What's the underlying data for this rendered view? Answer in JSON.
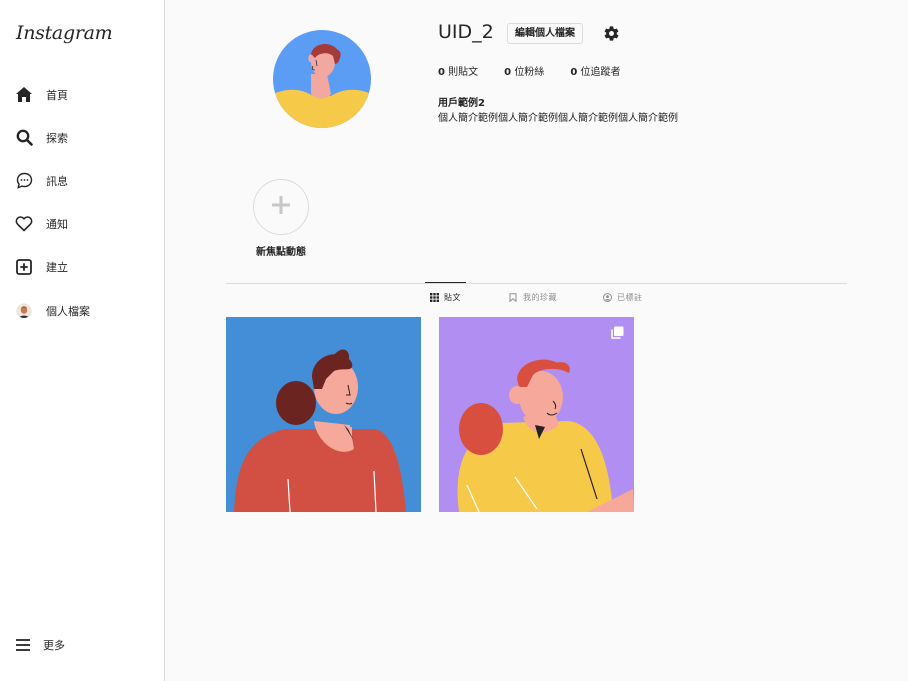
{
  "sidebar": {
    "logo": "Instagram",
    "items": [
      {
        "label": "首頁",
        "icon": "home-icon"
      },
      {
        "label": "探索",
        "icon": "search-icon"
      },
      {
        "label": "訊息",
        "icon": "message-icon"
      },
      {
        "label": "通知",
        "icon": "heart-icon"
      },
      {
        "label": "建立",
        "icon": "plus-square-icon"
      },
      {
        "label": "個人檔案",
        "icon": "avatar-icon"
      }
    ],
    "more": "更多"
  },
  "profile": {
    "username": "UID_2",
    "edit_label": "編輯個人檔案",
    "stats": {
      "posts_count": "0",
      "posts_label": "則貼文",
      "followers_count": "0",
      "followers_label": "位粉絲",
      "following_count": "0",
      "following_label": "位追蹤者"
    },
    "name": "用戶範例2",
    "bio": "個人簡介範例個人簡介範例個人簡介範例個人簡介範例"
  },
  "highlights": {
    "new_label": "新焦點動態"
  },
  "tabs": [
    {
      "label": "貼文",
      "icon": "grid-icon",
      "active": true
    },
    {
      "label": "我的珍藏",
      "icon": "bookmark-icon",
      "active": false
    },
    {
      "label": "已標註",
      "icon": "tagged-icon",
      "active": false
    }
  ],
  "colors": {
    "avatar_bg": "#5b9cf5",
    "post1_bg": "#438ed6",
    "post2_bg": "#b08ef2"
  }
}
